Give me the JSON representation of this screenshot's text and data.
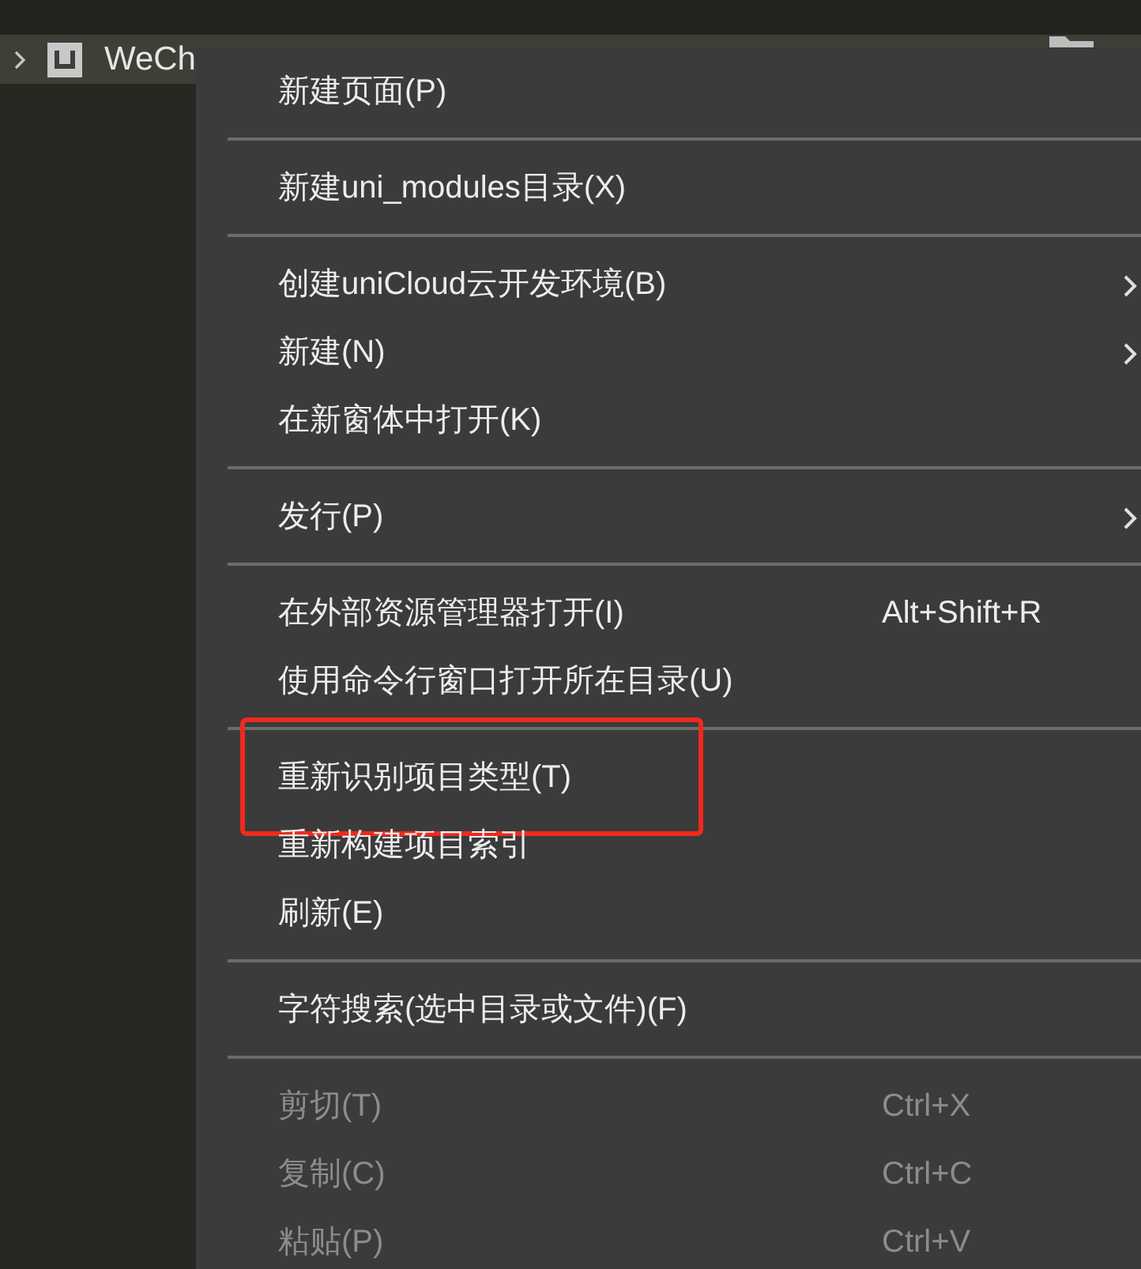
{
  "tree": {
    "project": {
      "title": "WeCh",
      "expanded": false
    }
  },
  "menu": {
    "sections": [
      [
        {
          "label": "新建页面(P)",
          "disabled": false,
          "has_submenu": false,
          "highlighted": false
        }
      ],
      [
        {
          "label": "新建uni_modules目录(X)",
          "disabled": false,
          "has_submenu": false,
          "highlighted": false
        }
      ],
      [
        {
          "label": "创建uniCloud云开发环境(B)",
          "disabled": false,
          "has_submenu": true,
          "highlighted": false
        },
        {
          "label": "新建(N)",
          "disabled": false,
          "has_submenu": true,
          "highlighted": false
        },
        {
          "label": "在新窗体中打开(K)",
          "disabled": false,
          "has_submenu": false,
          "highlighted": false
        }
      ],
      [
        {
          "label": "发行(P)",
          "disabled": false,
          "has_submenu": true,
          "highlighted": false
        }
      ],
      [
        {
          "label": "在外部资源管理器打开(I)",
          "shortcut": "Alt+Shift+R",
          "disabled": false,
          "has_submenu": false,
          "highlighted": false
        },
        {
          "label": "使用命令行窗口打开所在目录(U)",
          "disabled": false,
          "has_submenu": false,
          "highlighted": false
        }
      ],
      [
        {
          "label": "重新识别项目类型(T)",
          "disabled": false,
          "has_submenu": false,
          "highlighted": true
        },
        {
          "label": "重新构建项目索引",
          "disabled": false,
          "has_submenu": false,
          "highlighted": false
        },
        {
          "label": "刷新(E)",
          "disabled": false,
          "has_submenu": false,
          "highlighted": false
        }
      ],
      [
        {
          "label": "字符搜索(选中目录或文件)(F)",
          "disabled": false,
          "has_submenu": false,
          "highlighted": false
        }
      ],
      [
        {
          "label": "剪切(T)",
          "shortcut": "Ctrl+X",
          "disabled": true,
          "has_submenu": false,
          "highlighted": false
        },
        {
          "label": "复制(C)",
          "shortcut": "Ctrl+C",
          "disabled": true,
          "has_submenu": false,
          "highlighted": false
        },
        {
          "label": "粘贴(P)",
          "shortcut": "Ctrl+V",
          "disabled": true,
          "has_submenu": false,
          "highlighted": false
        }
      ]
    ]
  }
}
